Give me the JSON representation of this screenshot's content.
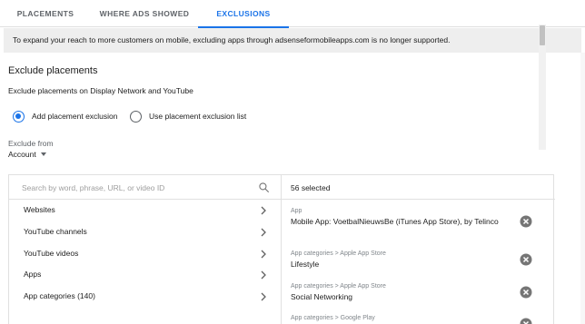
{
  "tabs": [
    {
      "label": "PLACEMENTS"
    },
    {
      "label": "WHERE ADS SHOWED"
    },
    {
      "label": "EXCLUSIONS"
    }
  ],
  "banner": "To expand your reach to more customers on mobile, excluding apps through adsenseformobileapps.com is no longer supported.",
  "section": {
    "title": "Exclude placements",
    "subtitle": "Exclude placements on Display Network and YouTube"
  },
  "radios": [
    {
      "label": "Add placement exclusion",
      "checked": true
    },
    {
      "label": "Use placement exclusion list",
      "checked": false
    }
  ],
  "exclude_from": {
    "label": "Exclude from",
    "value": "Account"
  },
  "search": {
    "placeholder": "Search by word, phrase, URL, or video ID"
  },
  "categories": [
    {
      "label": "Websites"
    },
    {
      "label": "YouTube channels"
    },
    {
      "label": "YouTube videos"
    },
    {
      "label": "Apps"
    },
    {
      "label": "App categories (140)"
    }
  ],
  "selected": {
    "count_label": "56 selected",
    "items": [
      {
        "category": "App",
        "name": "Mobile App: VoetbalNieuwsBe (iTunes App Store), by Telinco"
      },
      {
        "category": "App categories > Apple App Store",
        "name": "Lifestyle"
      },
      {
        "category": "App categories > Apple App Store",
        "name": "Social Networking"
      },
      {
        "category": "App categories > Google Play",
        "name": ""
      }
    ]
  },
  "colors": {
    "accent": "#1a73e8",
    "banner_bg": "#eeeeee",
    "icon_grey": "#757575"
  }
}
